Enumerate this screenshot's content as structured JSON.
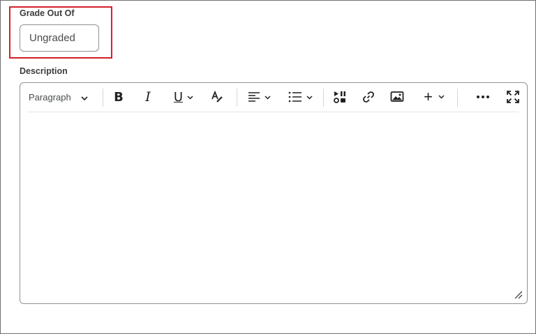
{
  "grade": {
    "label": "Grade Out Of",
    "value": "Ungraded"
  },
  "description": {
    "label": "Description",
    "editor": {
      "block_format": "Paragraph",
      "toolbar_buttons": [
        "bold",
        "italic",
        "underline",
        "format",
        "align",
        "list",
        "insert-stuff",
        "link",
        "image",
        "insert",
        "more",
        "fullscreen"
      ]
    }
  },
  "colors": {
    "highlight_border": "#d41f2b",
    "input_border": "#8e9195",
    "icon": "#202122"
  },
  "icons": {
    "bold": "B",
    "italic": "I",
    "underline": "U",
    "insert": "+",
    "more": "•••"
  }
}
